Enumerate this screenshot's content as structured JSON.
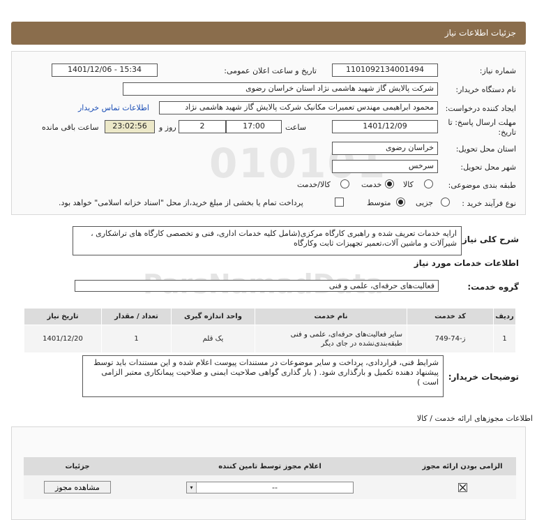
{
  "page_title": "جزئیات اطلاعات نیاز",
  "fields": {
    "need_number_label": "شماره نیاز:",
    "need_number": "1101092134001494",
    "announce_label": "تاریخ و ساعت اعلان عمومی:",
    "announce_value": "1401/12/06 - 15:34",
    "buyer_org_label": "نام دستگاه خریدار:",
    "buyer_org": "شرکت پالایش گاز شهید هاشمی نژاد   استان خراسان رضوی",
    "creator_label": "ایجاد کننده درخواست:",
    "creator": "محمود ابراهیمی مهندس تعمیرات مکانیک شرکت پالایش گاز شهید هاشمی نژاد",
    "contact_link": "اطلاعات تماس خریدار",
    "deadline_label_1": "مهلت ارسال پاسخ: تا",
    "deadline_label_2": "تاریخ:",
    "deadline_date": "1401/12/09",
    "time_label": "ساعت",
    "deadline_time": "17:00",
    "days_value": "2",
    "days_label": "روز و",
    "remaining_time": "23:02:56",
    "remaining_label": "ساعت باقی مانده",
    "delivery_province_label": "استان محل تحویل:",
    "delivery_province": "خراسان رضوی",
    "delivery_city_label": "شهر محل تحویل:",
    "delivery_city": "سرخس",
    "category_label": "طبقه بندی موضوعی:",
    "category_options": [
      "کالا",
      "خدمت",
      "کالا/خدمت"
    ],
    "purchase_type_label": "نوع فرآیند خرید :",
    "purchase_options": [
      "جزیی",
      "متوسط"
    ],
    "payment_note": "پرداخت تمام یا بخشی از مبلغ خرید،از محل \"اسناد خزانه اسلامی\" خواهد بود."
  },
  "general_desc_label": "شرح کلی نیاز:",
  "general_desc": "ارایه خدمات تعریف شده و راهبری کارگاه مرکزی(شامل کلیه خدمات اداری، فنی و تخصصی کارگاه های تراشکاری ، شیرآلات و ماشین آلات،تعمیر تجهیزات ثابت وکارگاه",
  "services_info_title": "اطلاعات خدمات مورد نیاز",
  "service_group_label": "گروه خدمت:",
  "service_group": "فعالیت‌های حرفه‌ای، علمی و فنی",
  "table": {
    "headers": [
      "ردیف",
      "کد خدمت",
      "نام خدمت",
      "واحد اندازه گیری",
      "تعداد / مقدار",
      "تاریخ نیاز"
    ],
    "rows": [
      [
        "1",
        "ز-74-749",
        "سایر فعالیت‌های حرفه‌ای، علمی و فنی طبقه‌بندی‌نشده در جای دیگر",
        "یک قلم",
        "1",
        "1401/12/20"
      ]
    ]
  },
  "buyer_notes_label": "توضیحات خریدار:",
  "buyer_notes": "شرایط فنی، قراردادی، پرداخت و سایر موضوعات در مستندات پیوست اعلام شده و این مستندات باید توسط پیشنهاد دهنده تکمیل و  بارگذاری شود. ( بار گذاری گواهی صلاحیت ایمنی و صلاحیت پیمانکاری معتبر الزامی است )",
  "license_section_title": "اطلاعات مجوزهای ارائه خدمت / کالا",
  "license_table": {
    "headers": [
      "الزامی بودن ارائه مجوز",
      "اعلام مجوز توسط تامین کننده",
      "جزئیات"
    ],
    "select_value": "--",
    "view_button": "مشاهده مجوز"
  },
  "watermark": "ParsNamadData"
}
